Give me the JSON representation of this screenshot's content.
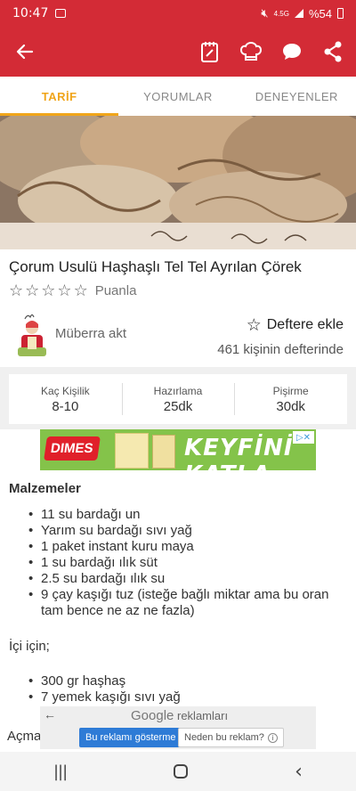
{
  "status_bar": {
    "time": "10:47",
    "network": "4.5G",
    "battery": "%54"
  },
  "app_bar": {
    "icons": [
      "back-arrow-icon",
      "notepad-icon",
      "chef-hat-icon",
      "chat-bubble-icon",
      "share-icon"
    ]
  },
  "tabs": [
    {
      "label": "TARİF",
      "active": true
    },
    {
      "label": "YORUMLAR",
      "active": false
    },
    {
      "label": "DENEYENLER",
      "active": false
    }
  ],
  "recipe": {
    "title": "Çorum Usulü Haşhaşlı Tel Tel Ayrılan Çörek",
    "rating_label": "Puanla",
    "stars": 5
  },
  "author": {
    "name": "Müberra akt",
    "add_to_notebook": "Deftere ekle",
    "notebook_count": "461 kişinin defterinde"
  },
  "info": [
    {
      "label": "Kaç Kişilik",
      "value": "8-10"
    },
    {
      "label": "Hazırlama",
      "value": "25dk"
    },
    {
      "label": "Pişirme",
      "value": "30dk"
    }
  ],
  "ad_banner": {
    "brand": "DIMES",
    "slogan": "KEYFİNİ KATLA"
  },
  "ingredients": {
    "title": "Malzemeler",
    "items": [
      "11 su bardağı un",
      "Yarım su bardağı sıvı yağ",
      "1 paket instant kuru maya",
      "1 su bardağı ılık süt",
      "2.5 su bardağı ılık su",
      "9 çay kaşığı tuz (isteğe bağlı miktar ama bu oran tam bence ne az ne fazla)"
    ],
    "filling_title": "İçi için;",
    "filling_items": [
      "300 gr haşhaş",
      "7 yemek kaşığı sıvı yağ"
    ],
    "next_heading": "Açma"
  },
  "google_ad": {
    "brand": "Google",
    "label": "reklamları",
    "show_button": "Bu reklamı gösterme",
    "why_button": "Neden bu reklam?"
  }
}
